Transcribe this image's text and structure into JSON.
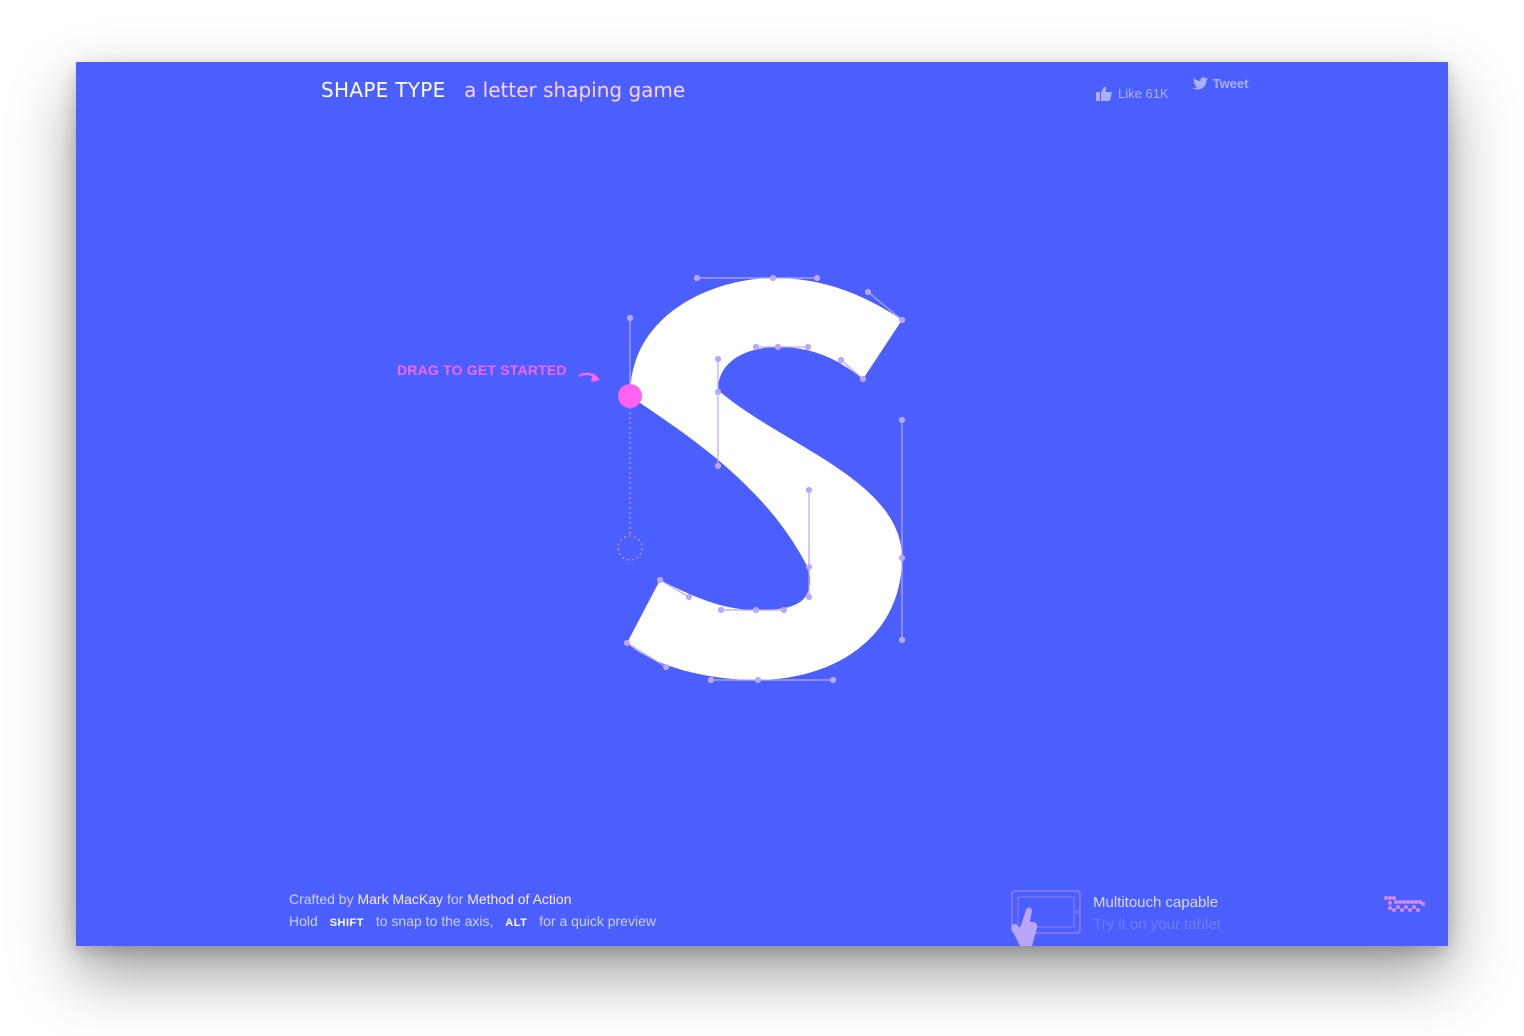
{
  "header": {
    "title": "SHAPE TYPE",
    "tagline": "a letter shaping game"
  },
  "social": {
    "like_label": "Like 61K",
    "tweet_label": "Tweet",
    "like_icon": "thumbs-up-icon",
    "tweet_icon": "twitter-bird-icon"
  },
  "game": {
    "letter": "S",
    "hint": "DRAG TO GET STARTED",
    "colors": {
      "background": "#4a5ffe",
      "letter_fill": "#ffffff",
      "handles": "#b9a6ff",
      "active_handle": "#ff62ee"
    }
  },
  "footer": {
    "crafted_prefix": "Crafted by",
    "author": "Mark MacKay",
    "crafted_for": "for",
    "company": "Method of Action",
    "hold": "Hold",
    "shift_key": "SHIFT",
    "shift_desc": "to snap to the axis,",
    "alt_key": "ALT",
    "alt_desc": "for a quick preview"
  },
  "multitouch": {
    "title": "Multitouch capable",
    "subtitle": "Try it on your tablet",
    "icon": "tablet-hand-icon"
  },
  "logo": {
    "text": "tttt",
    "icon": "tttt-logo-icon"
  }
}
